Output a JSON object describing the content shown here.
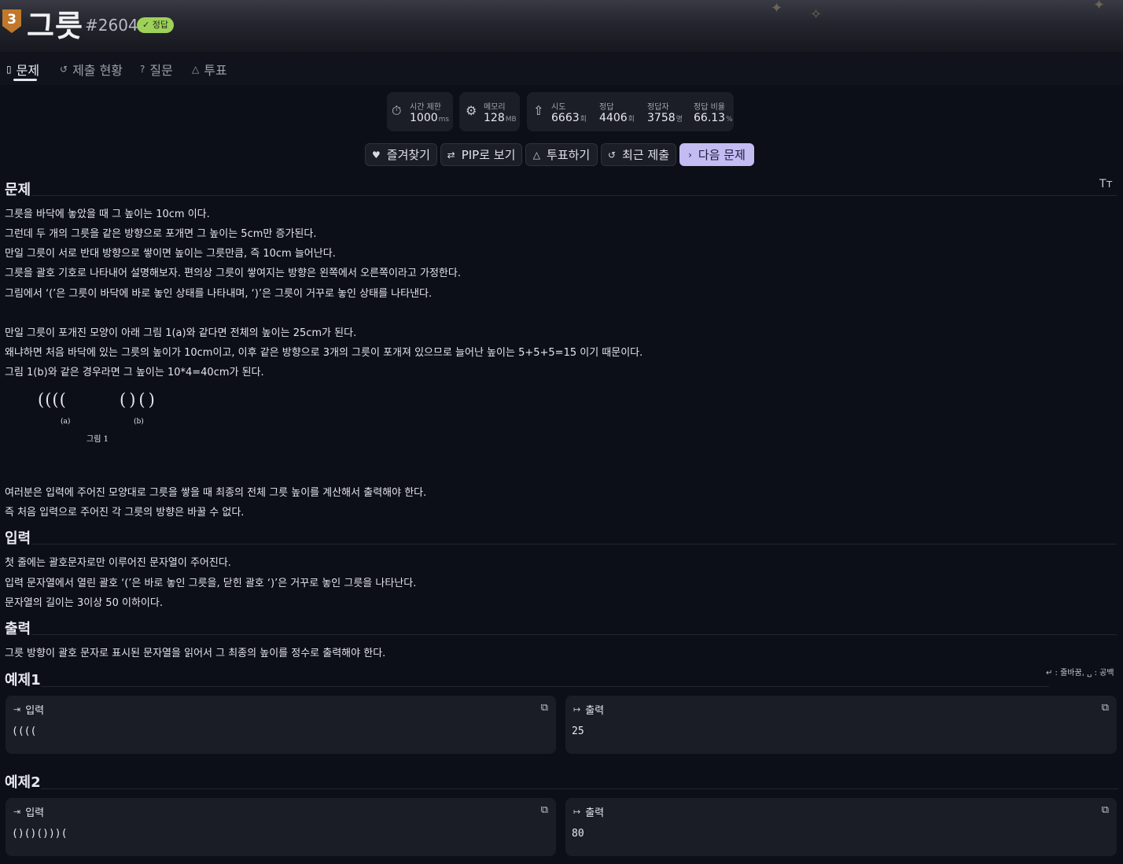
{
  "header": {
    "tier": "3",
    "title": "그릇",
    "problem_number": "#2604",
    "badge": "✓ 정답"
  },
  "tabs": [
    {
      "label": "문제",
      "icon": "document-icon"
    },
    {
      "label": "제출 현황",
      "icon": "history-icon"
    },
    {
      "label": "질문",
      "icon": "question-icon"
    },
    {
      "label": "투표",
      "icon": "vote-icon"
    }
  ],
  "stats": {
    "time_label": "시간 제한",
    "time_value": "1000",
    "time_unit": "ms",
    "memory_label": "메모리",
    "memory_value": "128",
    "memory_unit": "MB",
    "try_label": "시도",
    "try_value": "6663",
    "try_unit": "회",
    "correct_label": "정답",
    "correct_value": "4406",
    "correct_unit": "회",
    "solvers_label": "정답자",
    "solvers_value": "3758",
    "solvers_unit": "명",
    "ratio_label": "정답 비율",
    "ratio_value": "66.13",
    "ratio_unit": "%"
  },
  "actions": {
    "favorite": "즐겨찾기",
    "pip": "PIP로 보기",
    "vote": "투표하기",
    "recent": "최근 제출",
    "next": "다음 문제"
  },
  "problem": {
    "title": "문제",
    "font_toggle": "Tт",
    "lines": [
      "그릇을 바닥에 놓았을 때 그 높이는 10cm 이다.",
      "그런데 두 개의 그릇을 같은 방향으로 포개면 그 높이는 5cm만 증가된다.",
      "만일 그릇이 서로 반대 방향으로 쌓이면 높이는 그릇만큼, 즉 10cm 늘어난다.",
      "그릇을 괄호 기호로 나타내어 설명해보자. 편의상 그릇이 쌓여지는 방향은 왼쪽에서 오른쪽이라고 가정한다.",
      "그림에서 ‘(’은 그릇이 바닥에 바로 놓인 상태를 나타내며, ‘)’은 그릇이 거꾸로 놓인 상태를 나타낸다.",
      "만일 그릇이 포개진 모양이 아래 그림 1(a)와 같다면 전체의 높이는 25cm가 된다.",
      "왜냐하면 처음 바닥에 있는 그릇의 높이가 10cm이고, 이후 같은 방향으로 3개의 그릇이 포개져 있으므로 늘어난 높이는 5+5+5=15 이기 때문이다.",
      "그림 1(b)와 같은 경우라면 그 높이는 10*4=40cm가 된다.",
      "여러분은 입력에 주어진 모양대로 그릇을 쌓을 때 최종의 전체 그릇 높이를 계산해서 출력해야 한다.",
      "즉 처음 입력으로 주어진 각 그릇의 방향은 바꿀 수 없다."
    ],
    "figure": {
      "a_shape": "((((",
      "b_shape": "()()",
      "a_label": "(a)",
      "b_label": "(b)",
      "caption": "그림 1"
    }
  },
  "input": {
    "title": "입력",
    "lines": [
      "첫 줄에는 괄호문자로만 이루어진 문자열이 주어진다.",
      "입력 문자열에서 열린 괄호 ‘(’은 바로 놓인 그릇을, 닫힌 괄호 ‘)’은 거꾸로 놓인 그릇을 나타난다.",
      "문자열의 길이는 3이상 50 이하이다."
    ]
  },
  "output": {
    "title": "출력",
    "lines": [
      "그릇 방향이 괄호 문자로 표시된 문자열을 읽어서 그 최종의 높이를 정수로 출력해야 한다."
    ]
  },
  "legend": "↵ : 줄바꿈, ␣ : 공백",
  "examples": [
    {
      "title": "예제1",
      "input_label": "입력",
      "output_label": "출력",
      "input": "((((",
      "output": "25"
    },
    {
      "title": "예제2",
      "input_label": "입력",
      "output_label": "출력",
      "input": "()()()))(",
      "output": "80"
    }
  ]
}
